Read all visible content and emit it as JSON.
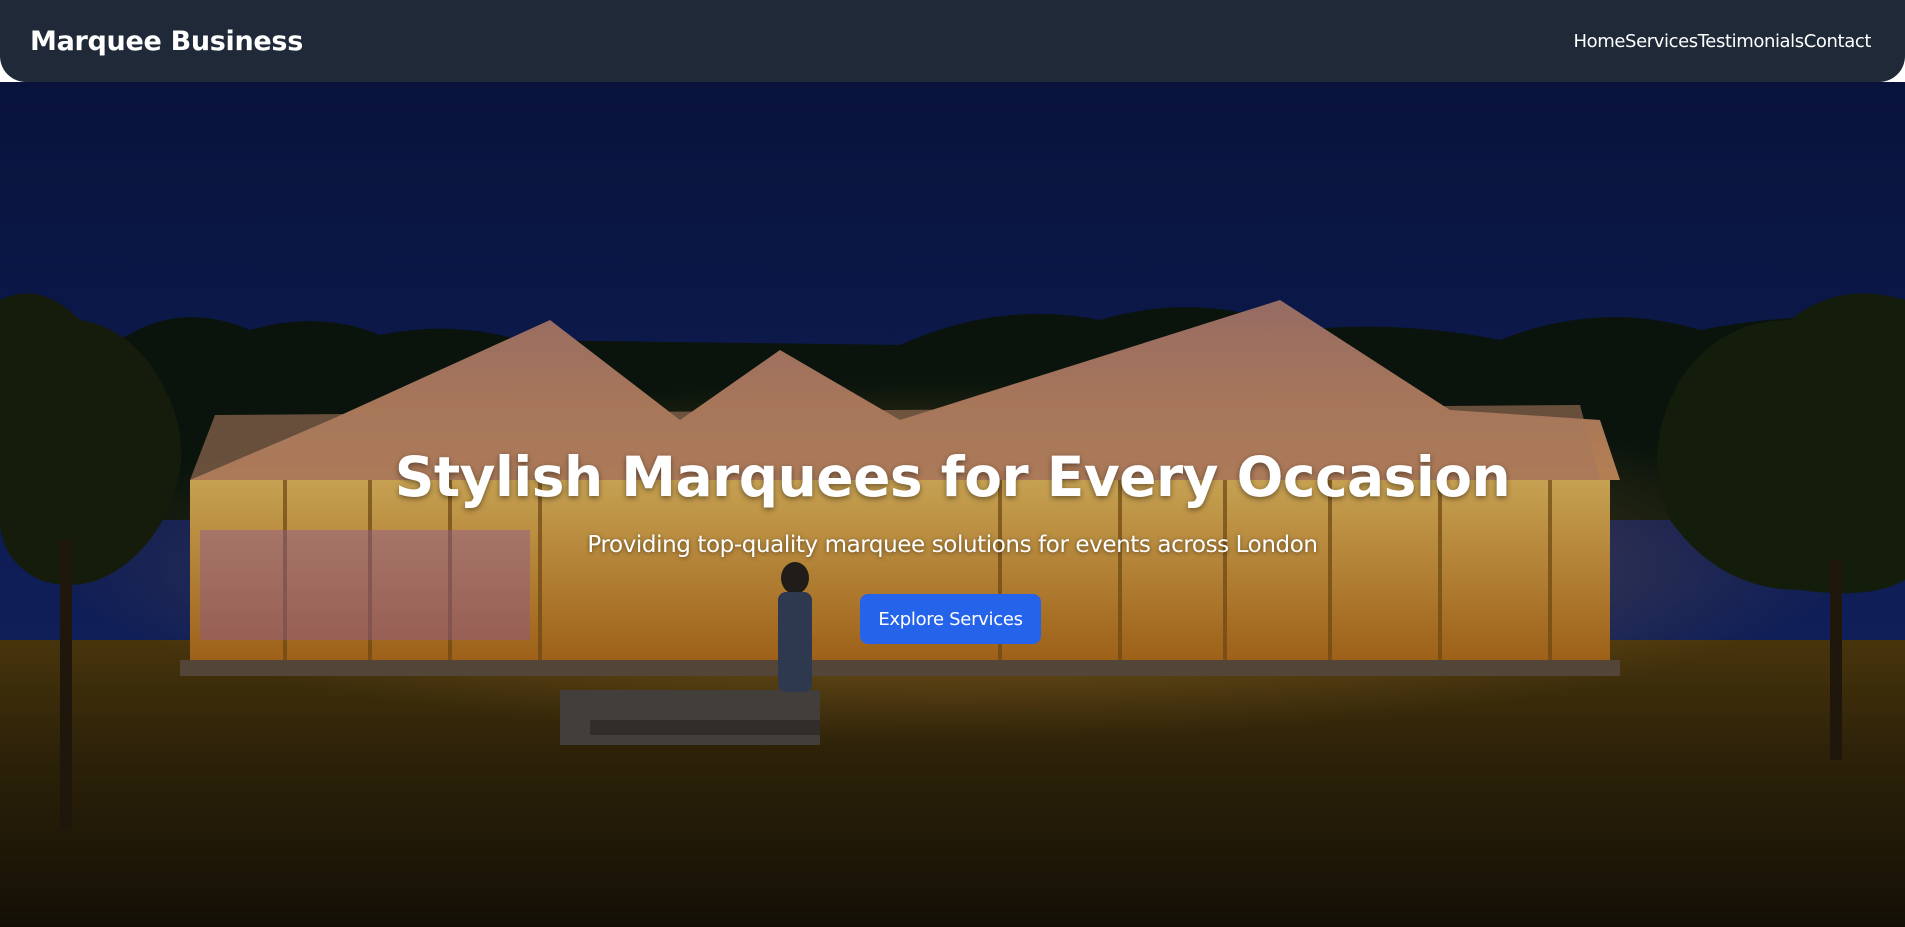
{
  "nav": {
    "brand": "Marquee Business",
    "links": [
      "Home",
      "Services",
      "Testimonials",
      "Contact"
    ]
  },
  "hero": {
    "title": "Stylish Marquees for Every Occasion",
    "subtitle": "Providing top-quality marquee solutions for events across London",
    "cta_label": "Explore Services",
    "background_image": "marquee-tent-night-photo"
  },
  "colors": {
    "navbar_bg": "#1f2937",
    "cta_bg": "#2563eb",
    "text": "#ffffff"
  }
}
